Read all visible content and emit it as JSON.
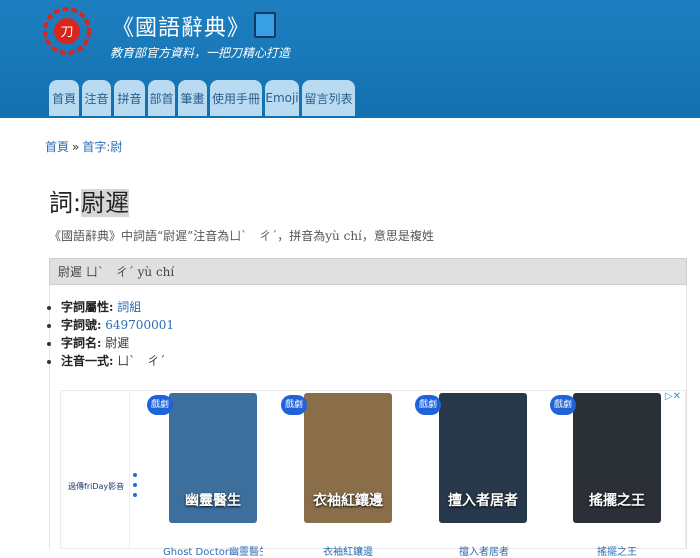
{
  "site": {
    "title": "《國語辭典》",
    "slogan": "教育部官方資料，一把刀精心打造",
    "logo_text": "刀"
  },
  "nav": {
    "tabs": [
      "首頁",
      "注音",
      "拼音",
      "部首",
      "筆畫",
      "使用手冊",
      "Emoji",
      "留言列表"
    ]
  },
  "breadcrumb": {
    "home": "首頁",
    "sep": "»",
    "current": "首字:尉"
  },
  "entry": {
    "title_prefix": "詞:",
    "word": "尉遲",
    "description": "《國語辭典》中詞語“尉遲”注音為ㄩˋ　ㄔˊ，拼音為yù chí，意思是複姓",
    "header": "尉遲 ㄩˋ　ㄔˊ yù chí",
    "properties": [
      {
        "key": "字詞屬性:",
        "value": "詞組",
        "link": true
      },
      {
        "key": "字詞號:",
        "value": "649700001",
        "link": true
      },
      {
        "key": "字詞名:",
        "value": "尉遲",
        "link": false
      },
      {
        "key": "注音一式:",
        "value": "ㄩˋ　ㄔˊ",
        "link": false
      }
    ]
  },
  "ad": {
    "brand": "過傳friDay影音",
    "adchoices": "▷✕",
    "badge": "戲劇",
    "items": [
      {
        "poster_text": "幽靈醫生",
        "caption": "Ghost Doctor幽靈醫生",
        "bg": "#3c6f9c"
      },
      {
        "poster_text": "衣袖紅鑲邊",
        "caption": "衣袖紅鑲邊",
        "bg": "#8a6e4a"
      },
      {
        "poster_text": "擅入者居者",
        "caption": "擅入者居者",
        "bg": "#27384a"
      },
      {
        "poster_text": "搖擺之王",
        "caption": "搖擺之王",
        "bg": "#2b2f36"
      }
    ]
  },
  "colors": {
    "header": "#1470b0",
    "tab": "#b8dbf2",
    "link": "#2a6db5"
  }
}
